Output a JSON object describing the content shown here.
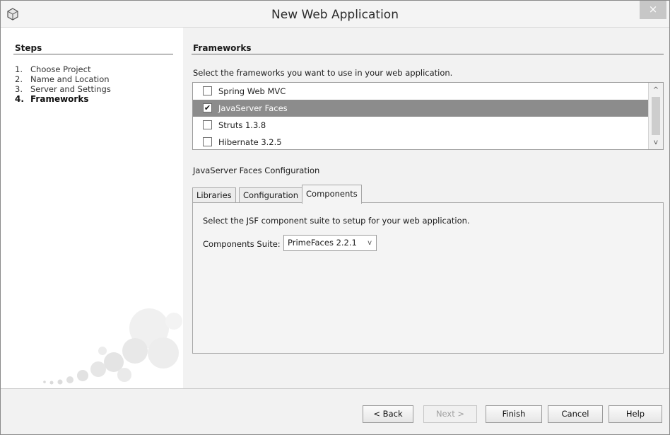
{
  "window": {
    "title": "New Web Application",
    "close_glyph": "×"
  },
  "steps": {
    "heading": "Steps",
    "items": [
      {
        "num": "1.",
        "label": "Choose Project",
        "active": false
      },
      {
        "num": "2.",
        "label": "Name and Location",
        "active": false
      },
      {
        "num": "3.",
        "label": "Server and Settings",
        "active": false
      },
      {
        "num": "4.",
        "label": "Frameworks",
        "active": true
      }
    ]
  },
  "frameworks": {
    "heading": "Frameworks",
    "instruction": "Select the frameworks you want to use in your web application.",
    "items": [
      {
        "label": "Spring Web MVC",
        "checked": false,
        "selected": false
      },
      {
        "label": "JavaServer Faces",
        "checked": true,
        "selected": true
      },
      {
        "label": "Struts 1.3.8",
        "checked": false,
        "selected": false
      },
      {
        "label": "Hibernate 3.2.5",
        "checked": false,
        "selected": false
      }
    ],
    "check_glyph": "✔",
    "scroll_up_glyph": "^",
    "scroll_down_glyph": "v"
  },
  "config": {
    "title": "JavaServer Faces Configuration",
    "tabs": [
      {
        "label": "Libraries",
        "active": false
      },
      {
        "label": "Configuration",
        "active": false
      },
      {
        "label": "Components",
        "active": true
      }
    ],
    "description": "Select the JSF component suite to setup for your web application.",
    "suite_label": "Components Suite:",
    "suite_value": "PrimeFaces 2.2.1",
    "suite_chevron": "v"
  },
  "buttons": {
    "back": "< Back",
    "next": "Next >",
    "finish": "Finish",
    "cancel": "Cancel",
    "help": "Help"
  },
  "colors": {
    "selected_row": "#8c8c8c",
    "close_button": "#c7c7c7"
  },
  "icons": {
    "app": "netbeans-cube-icon",
    "close": "close-icon",
    "decoration": "bubbles-decoration"
  }
}
